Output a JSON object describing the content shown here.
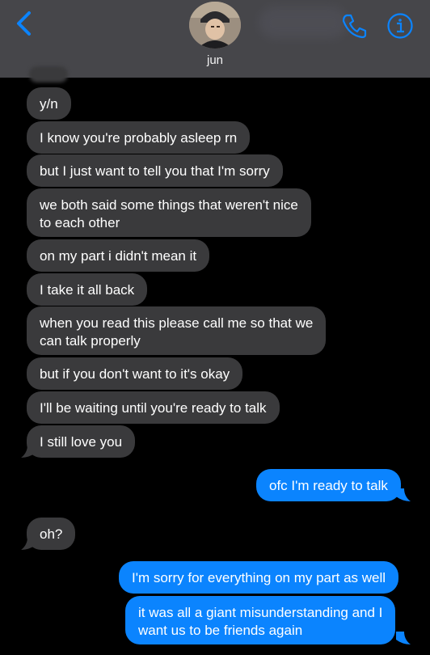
{
  "header": {
    "contact_name": "jun"
  },
  "icons": {
    "back": "chevron-left-icon",
    "phone": "phone-icon",
    "info": "info-icon"
  },
  "colors": {
    "header_bg": "#46464a",
    "accent": "#0b84fe",
    "incoming_bubble": "#3a3a3c",
    "background": "#000000"
  },
  "messages": [
    {
      "direction": "incoming",
      "text": "y/n"
    },
    {
      "direction": "incoming",
      "text": "I know you're probably asleep rn"
    },
    {
      "direction": "incoming",
      "text": "but I just want to tell you that I'm sorry"
    },
    {
      "direction": "incoming",
      "text": "we both said some things that weren't nice\nto each other"
    },
    {
      "direction": "incoming",
      "text": "on my part i didn't mean it"
    },
    {
      "direction": "incoming",
      "text": "I take it all back"
    },
    {
      "direction": "incoming",
      "text": "when you read this please call me so that we\ncan talk properly"
    },
    {
      "direction": "incoming",
      "text": "but if you don't want to it's okay"
    },
    {
      "direction": "incoming",
      "text": "I'll be waiting until you're ready to talk"
    },
    {
      "direction": "incoming",
      "text": "I still love you"
    },
    {
      "direction": "outgoing",
      "text": "ofc I'm ready to talk"
    },
    {
      "direction": "incoming",
      "text": "oh?"
    },
    {
      "direction": "outgoing",
      "text": "I'm sorry for everything on my part as well"
    },
    {
      "direction": "outgoing",
      "text": "it was all a giant misunderstanding and I\nwant us to be friends again"
    }
  ]
}
